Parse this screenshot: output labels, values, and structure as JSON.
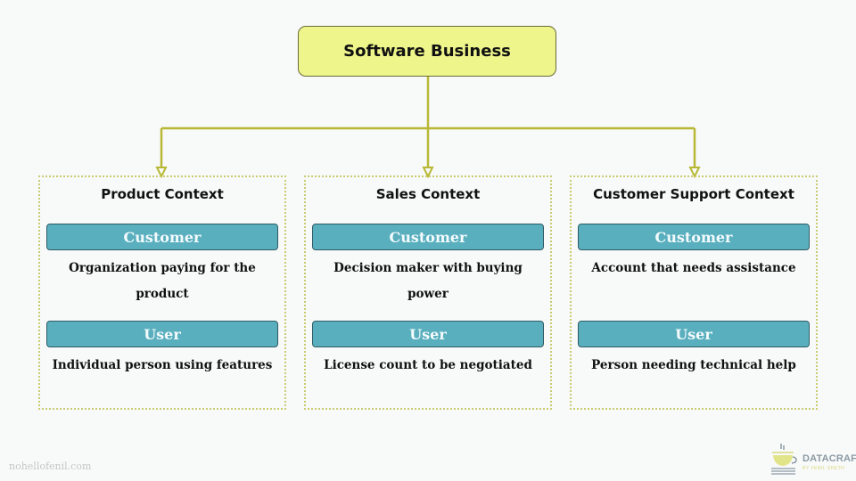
{
  "root": {
    "label": "Software Business"
  },
  "colors": {
    "root_fill": "#eef58a",
    "connector": "#b8b835",
    "role_fill": "#5aafbf",
    "dotted_border": "#c9cc70"
  },
  "contexts": [
    {
      "title": "Product Context",
      "customer": {
        "label": "Customer",
        "description": "Organization paying for the product"
      },
      "user": {
        "label": "User",
        "description": "Individual person using features"
      }
    },
    {
      "title": "Sales Context",
      "customer": {
        "label": "Customer",
        "description": "Decision maker with buying power"
      },
      "user": {
        "label": "User",
        "description": "License count to be negotiated"
      }
    },
    {
      "title": "Customer Support Context",
      "customer": {
        "label": "Customer",
        "description": "Account that needs assistance"
      },
      "user": {
        "label": "User",
        "description": "Person needing technical help"
      }
    }
  ],
  "footer": {
    "url": "nohellofenil.com",
    "logo_text": "DATACRAFT",
    "logo_subtext": "BY FENIL SHETH",
    "logo_icon": "coffee-cup-books-icon"
  }
}
